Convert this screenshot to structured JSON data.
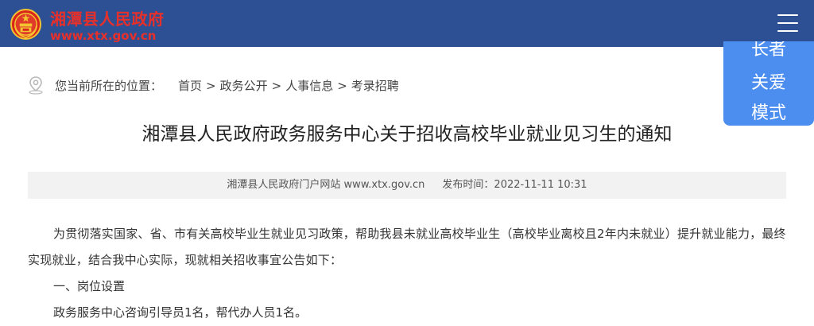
{
  "header": {
    "site_name": "湘潭县人民政府",
    "site_url": "www.xtx.gov.cn",
    "header_bg": "#2d4f93",
    "brand_color": "#e8302b",
    "logo_icon": "national-emblem-icon",
    "menu_icon": "hamburger-menu-icon"
  },
  "care_mode": {
    "lines": [
      "长者",
      "关爱",
      "模式"
    ],
    "color": "#4c8ef0"
  },
  "breadcrumb": {
    "icon": "location-pin-icon",
    "label": "您当前所在的位置：",
    "items": [
      "首页",
      "政务公开",
      "人事信息",
      "考录招聘"
    ],
    "separator": ">"
  },
  "article": {
    "title": "湘潭县人民政府政务服务中心关于招收高校毕业就业见习生的通知",
    "source": "湘潭县人民政府门户网站 www.xtx.gov.cn",
    "publish_time": "发布时间：2022-11-11 10:31",
    "paragraph_1": "为贯彻落实国家、省、市有关高校毕业生就业见习政策，帮助我县未就业高校毕业生（高校毕业离校且2年内未就业）提升就业能力，最终实现就业，结合我中心实际，现就相关招收事宜公告如下：",
    "section_1": "一、岗位设置",
    "line_1": "政务服务中心咨询引导员1名，帮代办人员1名。"
  }
}
